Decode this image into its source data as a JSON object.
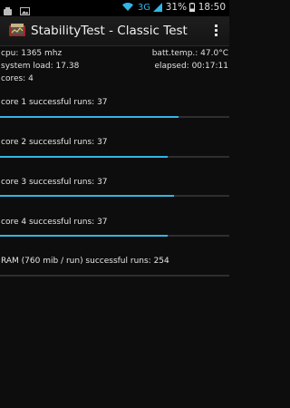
{
  "status_bar": {
    "network": "3G",
    "battery": "31%",
    "time": "18:50",
    "icons": [
      "android-debug-icon",
      "image-icon",
      "wifi-icon",
      "signal-icon",
      "battery-icon"
    ]
  },
  "action_bar": {
    "title": "StabilityTest - Classic Test",
    "app_icon": "stability-test-app-icon",
    "overflow_icon": "overflow-menu-icon"
  },
  "stats": {
    "cpu": "cpu: 1365 mhz",
    "batt_temp": "batt.temp.: 47.0°C",
    "system_load": "system load: 17.38",
    "elapsed": "elapsed: 00:17:11",
    "cores": "cores: 4"
  },
  "tests": [
    {
      "label": "core 1 successful runs: 37",
      "progress": 0.78
    },
    {
      "label": "core 2 successful runs: 37",
      "progress": 0.73
    },
    {
      "label": "core 3 successful runs: 37",
      "progress": 0.76
    },
    {
      "label": "core 4 successful runs: 37",
      "progress": 0.73
    },
    {
      "label": "RAM (760 mib / run) successful runs: 254",
      "progress": 0.0
    }
  ],
  "colors": {
    "accent": "#33b5e5",
    "background": "#0d0d0d",
    "track": "#2e2e2e"
  }
}
